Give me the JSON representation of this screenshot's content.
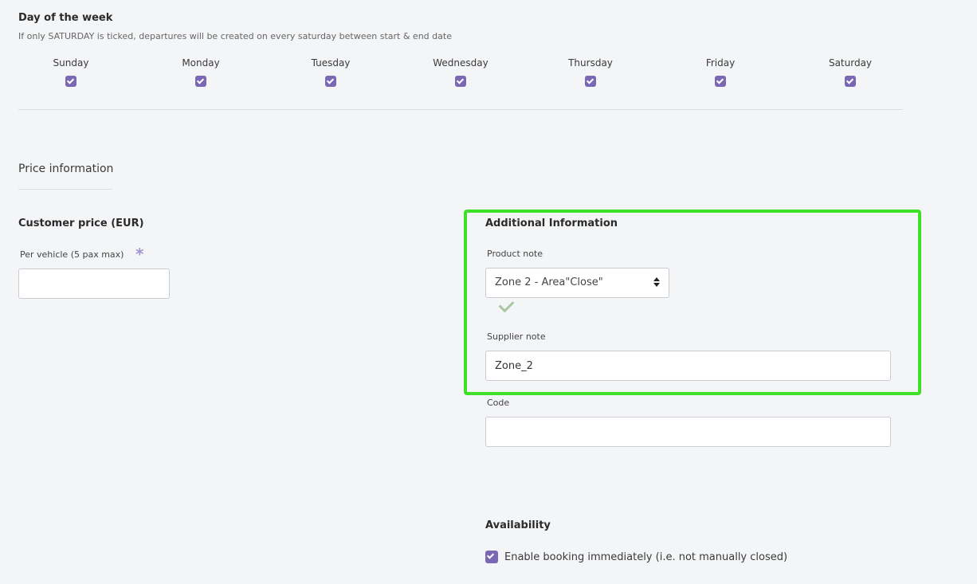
{
  "day_of_week": {
    "title": "Day of the week",
    "hint": "If only SATURDAY is ticked, departures will be created on every saturday between start & end date",
    "days": [
      {
        "label": "Sunday",
        "checked": true
      },
      {
        "label": "Monday",
        "checked": true
      },
      {
        "label": "Tuesday",
        "checked": true
      },
      {
        "label": "Wednesday",
        "checked": true
      },
      {
        "label": "Thursday",
        "checked": true
      },
      {
        "label": "Friday",
        "checked": true
      },
      {
        "label": "Saturday",
        "checked": true
      }
    ]
  },
  "price_information": {
    "title": "Price information",
    "customer_price_title": "Customer price (EUR)",
    "per_vehicle_label": "Per vehicle (5 pax max)",
    "required_marker": "*",
    "per_vehicle_value": ""
  },
  "additional_information": {
    "title": "Additional Information",
    "product_note_label": "Product note",
    "product_note_selected": "Zone 2 - Area\"Close\"",
    "supplier_note_label": "Supplier note",
    "supplier_note_value": "Zone_2",
    "code_label": "Code",
    "code_value": ""
  },
  "availability": {
    "title": "Availability",
    "enable_booking_label": "Enable booking immediately (i.e. not manually closed)",
    "enable_booking_checked": true
  },
  "colors": {
    "accent_purple": "#7b68b5",
    "highlight_green": "#3ee028",
    "valid_check": "#a9c7a0"
  }
}
